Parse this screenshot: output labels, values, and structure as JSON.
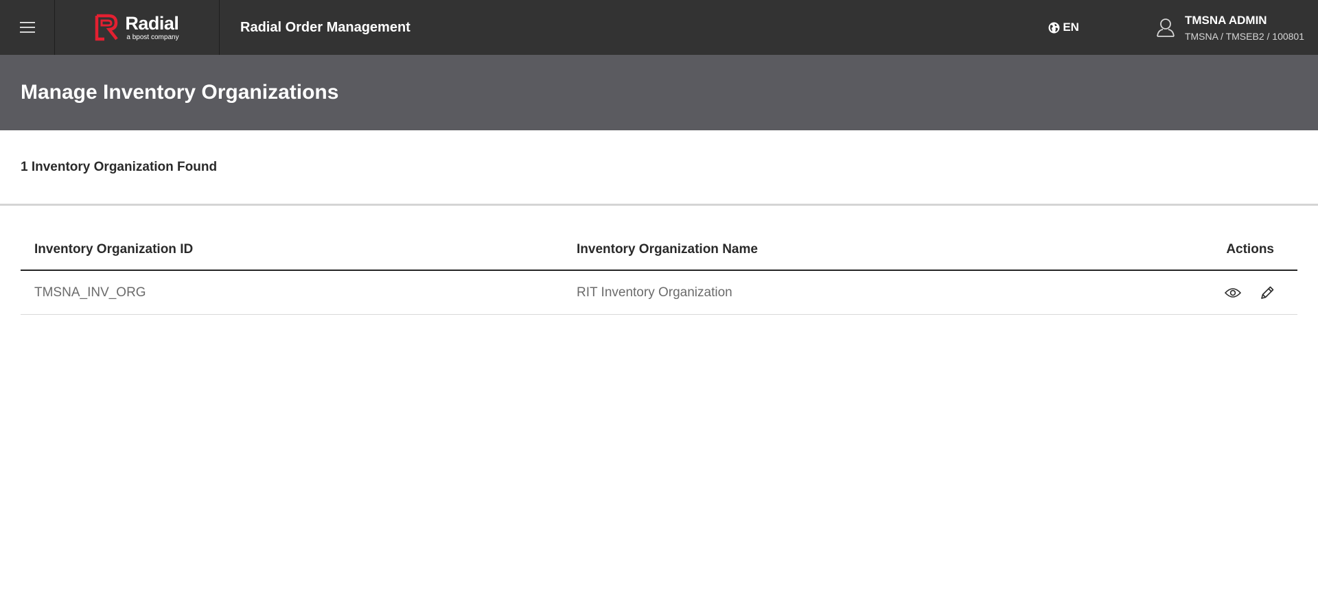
{
  "header": {
    "brand": "Radial",
    "tagline": "a bpost company",
    "app_title": "Radial Order Management",
    "language": "EN",
    "user_name": "TMSNA ADMIN",
    "user_context": "TMSNA / TMSEB2 / 100801"
  },
  "page": {
    "title": "Manage Inventory Organizations",
    "results_count": "1 Inventory Organization Found"
  },
  "table": {
    "columns": {
      "id": "Inventory Organization ID",
      "name": "Inventory Organization Name",
      "actions": "Actions"
    },
    "rows": [
      {
        "id": "TMSNA_INV_ORG",
        "name": "RIT Inventory Organization"
      }
    ]
  },
  "icons": {
    "menu": "hamburger-menu-icon",
    "logo": "radial-logo-icon",
    "language": "globe-icon",
    "user": "user-icon",
    "view": "eye-icon",
    "edit": "pencil-icon"
  },
  "colors": {
    "topbar": "#333333",
    "title_band": "#5b5b60",
    "brand_red": "#e32031"
  }
}
